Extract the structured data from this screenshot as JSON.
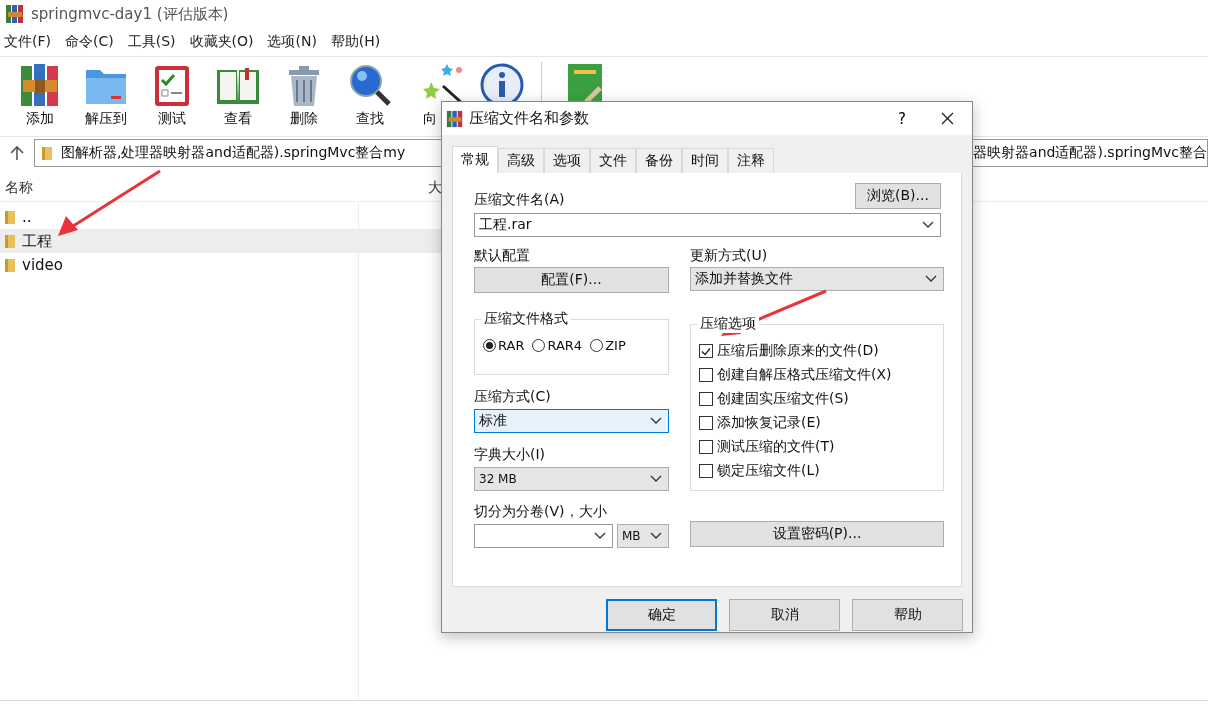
{
  "window": {
    "title": "springmvc-day1 (评估版本)"
  },
  "menu": [
    "文件(F)",
    "命令(C)",
    "工具(S)",
    "收藏夹(O)",
    "选项(N)",
    "帮助(H)"
  ],
  "toolbar": [
    {
      "kind": "add",
      "label": "添加"
    },
    {
      "kind": "extract",
      "label": "解压到"
    },
    {
      "kind": "test",
      "label": "测试"
    },
    {
      "kind": "view",
      "label": "查看"
    },
    {
      "kind": "delete",
      "label": "删除"
    },
    {
      "kind": "find",
      "label": "查找"
    },
    {
      "kind": "wizard",
      "label": "向"
    },
    {
      "kind": "info"
    },
    {
      "kind": "separator"
    },
    {
      "kind": "repair"
    }
  ],
  "address": {
    "path_left": "图解析器,处理器映射器and适配器).springMvc整合my",
    "path_right": "器映射器and适配器).springMvc整合"
  },
  "columns": [
    "名称",
    "大"
  ],
  "files": [
    {
      "name": "..",
      "selected": false
    },
    {
      "name": "工程",
      "selected": true
    },
    {
      "name": "video",
      "selected": false
    }
  ],
  "dialog": {
    "title": "压缩文件名和参数",
    "help": "?",
    "tabs": [
      {
        "label": "常规",
        "selected": true
      },
      {
        "label": "高级",
        "selected": false
      },
      {
        "label": "选项",
        "selected": false
      },
      {
        "label": "文件",
        "selected": false
      },
      {
        "label": "备份",
        "selected": false
      },
      {
        "label": "时间",
        "selected": false
      },
      {
        "label": "注释",
        "selected": false
      }
    ],
    "archive_name_label": "压缩文件名(A)",
    "archive_name": "工程.rar",
    "browse_button": "浏览(B)...",
    "profiles_label": "默认配置",
    "profiles_button": "配置(F)...",
    "update_label": "更新方式(U)",
    "update_mode": "添加并替换文件",
    "format_title": "压缩文件格式",
    "formats": [
      {
        "label": "RAR",
        "selected": true
      },
      {
        "label": "RAR4",
        "selected": false
      },
      {
        "label": "ZIP",
        "selected": false
      }
    ],
    "method_label": "压缩方式(C)",
    "method": "标准",
    "dict_label": "字典大小(I)",
    "dict": "32 MB",
    "split_label": "切分为分卷(V)，大小",
    "split_unit": "MB",
    "options_title": "压缩选项",
    "options": [
      {
        "label": "压缩后删除原来的文件(D)",
        "checked": true
      },
      {
        "label": "创建自解压格式压缩文件(X)",
        "checked": false
      },
      {
        "label": "创建固实压缩文件(S)",
        "checked": false
      },
      {
        "label": "添加恢复记录(E)",
        "checked": false
      },
      {
        "label": "测试压缩的文件(T)",
        "checked": false
      },
      {
        "label": "锁定压缩文件(L)",
        "checked": false
      }
    ],
    "password_button": "设置密码(P)...",
    "buttons": [
      {
        "label": "确定",
        "default": true
      },
      {
        "label": "取消",
        "default": false
      },
      {
        "label": "帮助",
        "default": false
      }
    ]
  }
}
